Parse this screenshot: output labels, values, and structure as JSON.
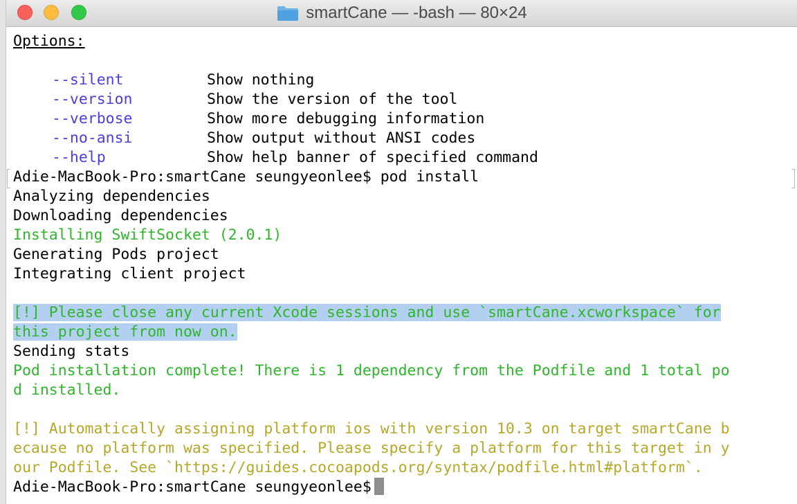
{
  "window": {
    "title": "smartCane — -bash — 80×24"
  },
  "terminal": {
    "options_heading": "Options:",
    "options": [
      {
        "flag": "--silent",
        "desc": "Show nothing"
      },
      {
        "flag": "--version",
        "desc": "Show the version of the tool"
      },
      {
        "flag": "--verbose",
        "desc": "Show more debugging information"
      },
      {
        "flag": "--no-ansi",
        "desc": "Show output without ANSI codes"
      },
      {
        "flag": "--help",
        "desc": "Show help banner of specified command"
      }
    ],
    "prompt1": "Adie-MacBook-Pro:smartCane seungyeonlee$ pod install",
    "analyzing": "Analyzing dependencies",
    "downloading": "Downloading dependencies",
    "installing": "Installing SwiftSocket (2.0.1)",
    "generating": "Generating Pods project",
    "integrating": "Integrating client project",
    "notice1_line1": "[!] Please close any current Xcode sessions and use `smartCane.xcworkspace` for",
    "notice1_line2": "this project from now on.",
    "sending": "Sending stats",
    "complete_line1": "Pod installation complete! There is 1 dependency from the Podfile and 1 total po",
    "complete_line2": "d installed.",
    "warn_line1": "[!] Automatically assigning platform ios with version 10.3 on target smartCane b",
    "warn_line2": "ecause no platform was specified. Please specify a platform for this target in y",
    "warn_line3": "our Podfile. See `https://guides.cocoapods.org/syntax/podfile.html#platform`.",
    "prompt2": "Adie-MacBook-Pro:smartCane seungyeonlee$"
  },
  "colors": {
    "option_flag": "#4b3fd9",
    "success": "#2fb52c",
    "warning": "#b4a82a",
    "selection": "#b3d0f0"
  }
}
